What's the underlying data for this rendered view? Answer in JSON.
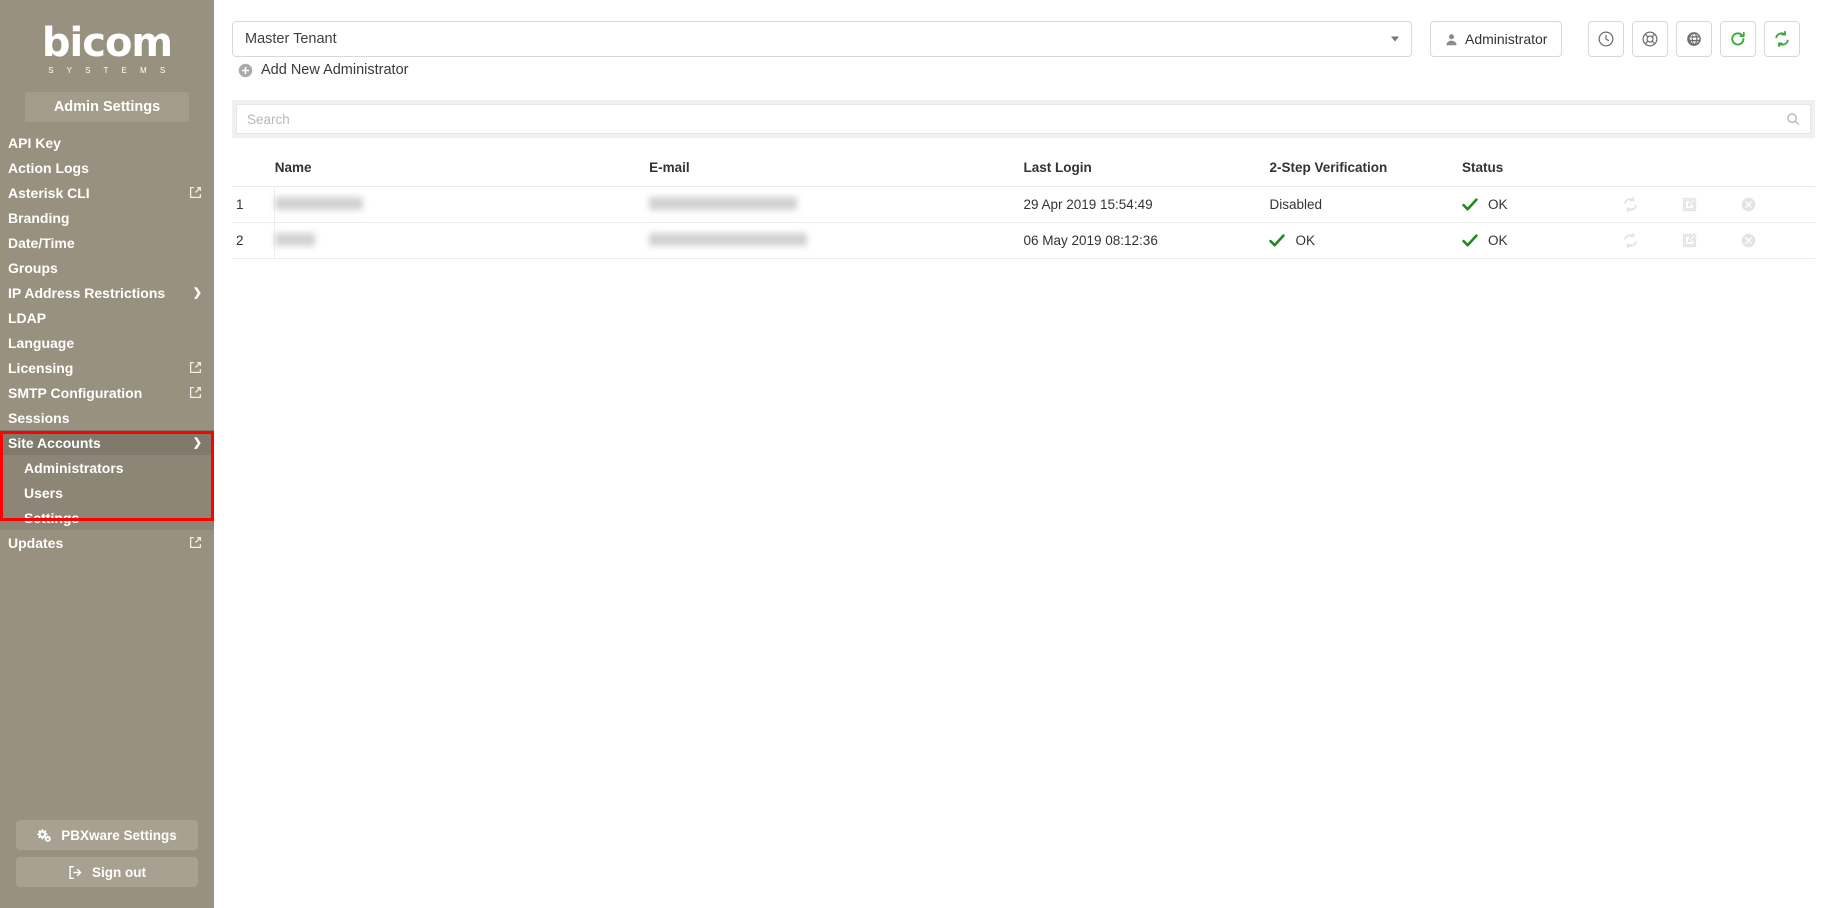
{
  "brand": {
    "logo_word": "bicom",
    "logo_sub": "S Y S T E M S",
    "sidebar_bg": "#98917f",
    "accent_green": "#3aa83a",
    "highlight_red": "#ff0000"
  },
  "sidebar": {
    "section_title": "Admin Settings",
    "items": [
      {
        "label": "API Key",
        "icon": "",
        "level": 0
      },
      {
        "label": "Action Logs",
        "icon": "",
        "level": 0
      },
      {
        "label": "Asterisk CLI",
        "icon": "external-link-icon",
        "level": 0
      },
      {
        "label": "Branding",
        "icon": "",
        "level": 0
      },
      {
        "label": "Date/Time",
        "icon": "",
        "level": 0
      },
      {
        "label": "Groups",
        "icon": "",
        "level": 0
      },
      {
        "label": "IP Address Restrictions",
        "icon": "chevron-right-icon",
        "level": 0
      },
      {
        "label": "LDAP",
        "icon": "",
        "level": 0
      },
      {
        "label": "Language",
        "icon": "",
        "level": 0
      },
      {
        "label": "Licensing",
        "icon": "external-link-icon",
        "level": 0
      },
      {
        "label": "SMTP Configuration",
        "icon": "external-link-icon",
        "level": 0
      },
      {
        "label": "Sessions",
        "icon": "",
        "level": 0
      },
      {
        "label": "Site Accounts",
        "icon": "chevron-down-icon",
        "level": 0
      },
      {
        "label": "Administrators",
        "icon": "",
        "level": 1
      },
      {
        "label": "Users",
        "icon": "",
        "level": 1
      },
      {
        "label": "Settings",
        "icon": "",
        "level": 1
      },
      {
        "label": "Updates",
        "icon": "external-link-icon",
        "level": 0
      }
    ],
    "buttons": [
      {
        "label": "PBXware Settings",
        "icon": "gears-icon"
      },
      {
        "label": "Sign out",
        "icon": "sign-out-icon"
      }
    ]
  },
  "topbar": {
    "tenant_selected": "Master Tenant",
    "admin_button": "Administrator",
    "icon_buttons": [
      {
        "name": "clock-icon"
      },
      {
        "name": "lifebuoy-icon"
      },
      {
        "name": "globe-icon"
      },
      {
        "name": "reload-icon"
      },
      {
        "name": "sync-icon"
      }
    ]
  },
  "actions": {
    "add_new": "Add New Administrator"
  },
  "search": {
    "placeholder": "Search",
    "value": ""
  },
  "table": {
    "columns": [
      "",
      "Name",
      "E-mail",
      "Last Login",
      "2-Step Verification",
      "Status",
      ""
    ],
    "rows": [
      {
        "index": "1",
        "name": "",
        "email": "",
        "last_login": "29 Apr 2019 15:54:49",
        "two_step": "Disabled",
        "two_step_ok": false,
        "status": "OK",
        "status_ok": true,
        "row_actions": [
          "sync-icon",
          "edit-icon",
          "delete-icon"
        ]
      },
      {
        "index": "2",
        "name": "",
        "email": "",
        "last_login": "06 May 2019 08:12:36",
        "two_step": "OK",
        "two_step_ok": true,
        "status": "OK",
        "status_ok": true,
        "row_actions": [
          "sync-icon",
          "edit-icon",
          "delete-icon"
        ]
      }
    ]
  }
}
